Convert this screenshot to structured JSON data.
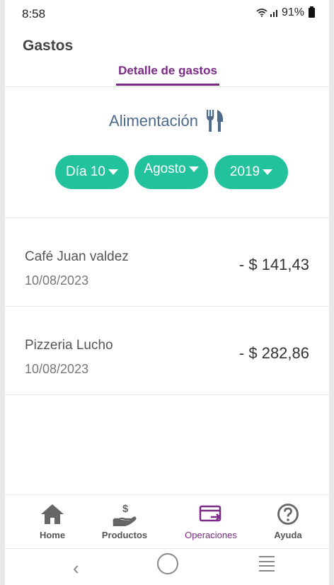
{
  "status": {
    "time": "8:58",
    "battery": "91%"
  },
  "header": {
    "title": "Gastos",
    "tab": "Detalle de gastos"
  },
  "category": {
    "label": "Alimentación",
    "icon": "fork-knife-icon"
  },
  "filters": {
    "day": "Día 10",
    "month": "Agosto",
    "year": "2019"
  },
  "transactions": [
    {
      "name": "Café Juan valdez",
      "date": "10/08/2023",
      "amount": "- $ 141,43"
    },
    {
      "name": "Pizzeria Lucho",
      "date": "10/08/2023",
      "amount": "- $ 282,86"
    }
  ],
  "nav": [
    {
      "label": "Home",
      "icon": "home-icon"
    },
    {
      "label": "Productos",
      "icon": "hand-dollar-icon"
    },
    {
      "label": "Operaciones",
      "icon": "card-transfer-icon"
    },
    {
      "label": "Ayuda",
      "icon": "help-circle-icon"
    }
  ],
  "colors": {
    "accent": "#7b2a86",
    "pill": "#22c29c",
    "category": "#4d6a8a"
  }
}
